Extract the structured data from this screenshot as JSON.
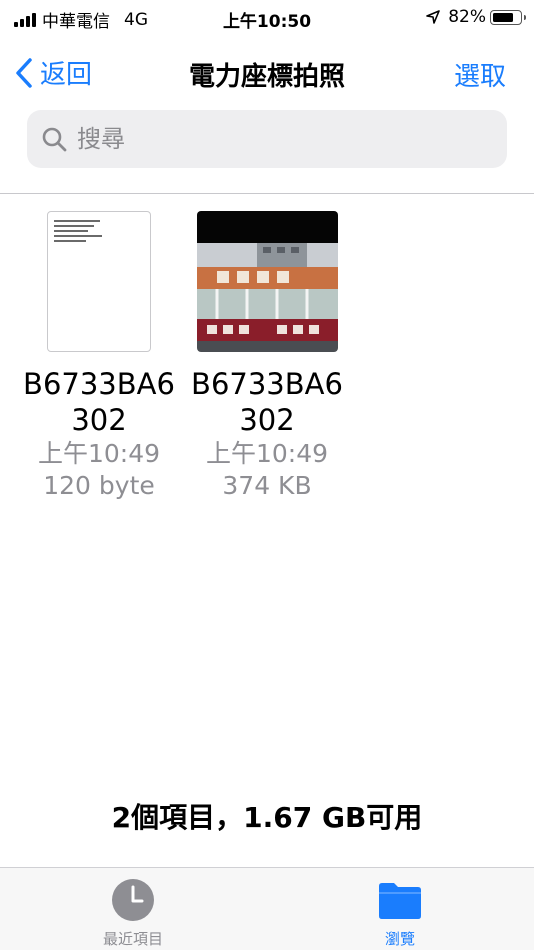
{
  "status_bar": {
    "carrier": "中華電信",
    "network": "4G",
    "time": "上午10:50",
    "battery_percent": "82%",
    "battery_level": 0.82
  },
  "nav": {
    "back_label": "返回",
    "title": "電力座標拍照",
    "select_label": "選取"
  },
  "search": {
    "placeholder": "搜尋",
    "value": ""
  },
  "files": [
    {
      "name": "B6733BA6302",
      "time": "上午10:49",
      "size": "120 byte",
      "kind": "document"
    },
    {
      "name": "B6733BA6302",
      "time": "上午10:49",
      "size": "374 KB",
      "kind": "image"
    }
  ],
  "summary": "2個項目，1.67 GB可用",
  "tabs": {
    "recent_label": "最近項目",
    "browse_label": "瀏覽"
  },
  "colors": {
    "accent": "#1a7dfd",
    "secondary_text": "#8e8e93"
  }
}
